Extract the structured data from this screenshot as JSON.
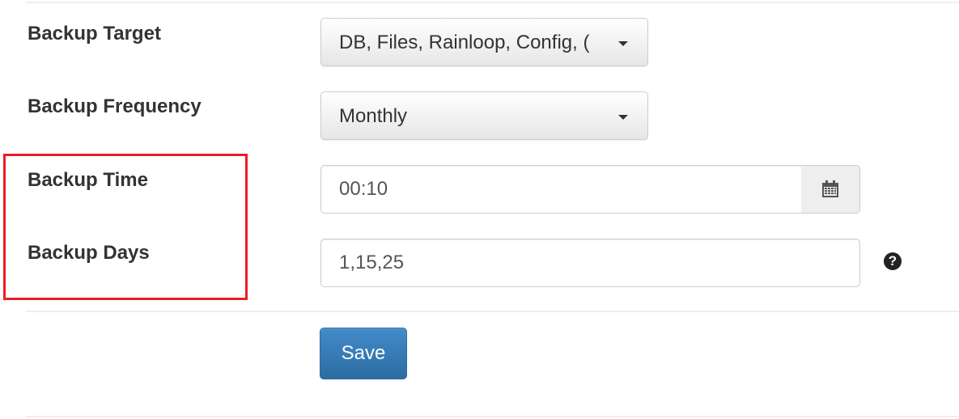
{
  "form": {
    "backup_target": {
      "label": "Backup Target",
      "selected": "DB, Files, Rainloop, Config, ("
    },
    "backup_frequency": {
      "label": "Backup Frequency",
      "selected": "Monthly"
    },
    "backup_time": {
      "label": "Backup Time",
      "value": "00:10",
      "addon_icon": "calendar-icon"
    },
    "backup_days": {
      "label": "Backup Days",
      "value": "1,15,25",
      "help_icon": "question-circle-icon",
      "help_glyph": "?"
    },
    "save_label": "Save"
  },
  "colors": {
    "highlight": "#ee1c24",
    "primary": "#428bca"
  }
}
